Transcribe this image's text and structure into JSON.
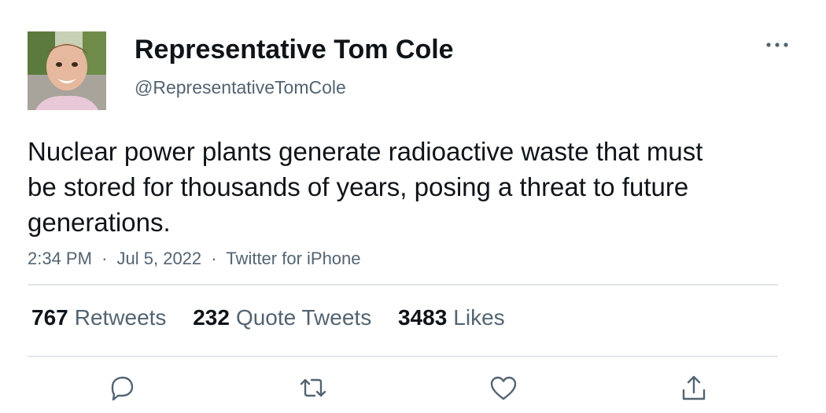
{
  "author": {
    "display_name": "Representative Tom Cole",
    "handle": "@RepresentativeTomCole",
    "avatar_icon": "profile-photo"
  },
  "tweet": {
    "text": "Nuclear power plants generate radioactive waste that must be stored for thousands of years, posing a threat to future generations.",
    "time": "2:34 PM",
    "date": "Jul 5, 2022",
    "source": "Twitter for iPhone",
    "separator": "·"
  },
  "stats": {
    "retweets_count": "767",
    "retweets_label": "Retweets",
    "quotes_count": "232",
    "quotes_label": "Quote Tweets",
    "likes_count": "3483",
    "likes_label": "Likes"
  },
  "actions": {
    "icons": [
      "reply-icon",
      "retweet-icon",
      "like-icon",
      "share-icon"
    ]
  },
  "colors": {
    "text": "#0f1419",
    "secondary": "#536471",
    "divider": "#e3e7ea"
  }
}
